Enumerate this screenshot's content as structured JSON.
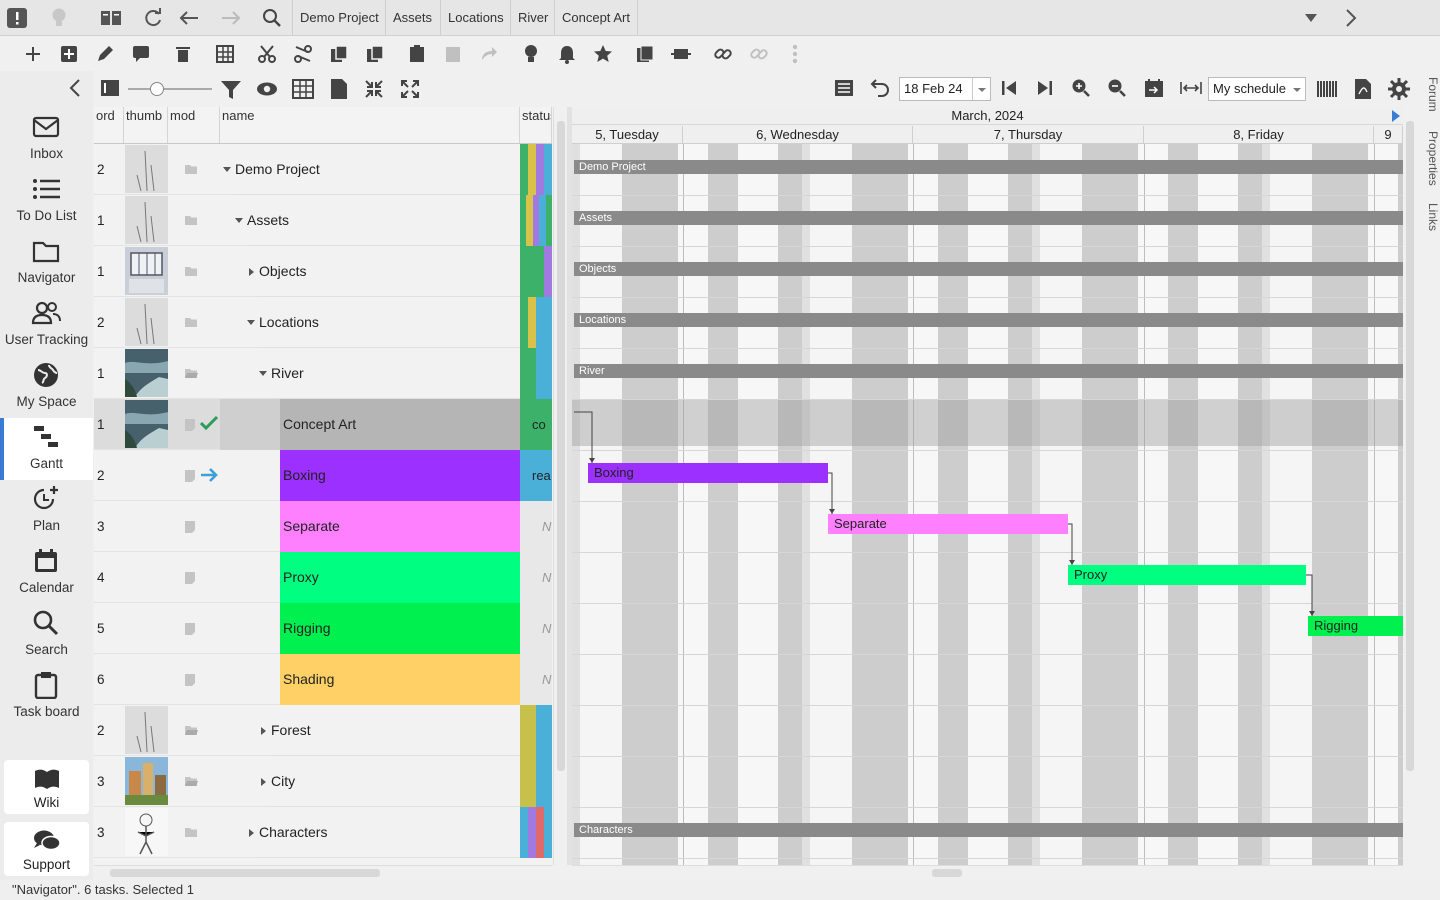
{
  "breadcrumbs": [
    "Demo Project",
    "Assets",
    "Locations",
    "River",
    "Concept Art"
  ],
  "schedule_toolbar": {
    "date": "18 Feb 24",
    "schedule": "My schedule"
  },
  "sidebar": {
    "items": [
      {
        "label": "Inbox",
        "icon": "inbox-icon"
      },
      {
        "label": "To Do List",
        "icon": "todo-list-icon"
      },
      {
        "label": "Navigator",
        "icon": "folder-icon"
      },
      {
        "label": "User Tracking",
        "icon": "users-icon"
      },
      {
        "label": "My Space",
        "icon": "globe-icon"
      },
      {
        "label": "Gantt",
        "icon": "gantt-icon",
        "active": true
      },
      {
        "label": "Plan",
        "icon": "plan-icon"
      },
      {
        "label": "Calendar",
        "icon": "calendar-icon"
      },
      {
        "label": "Search",
        "icon": "search-icon"
      },
      {
        "label": "Task board",
        "icon": "clipboard-icon"
      }
    ],
    "wiki": "Wiki",
    "support": "Support"
  },
  "table": {
    "columns": [
      "ord",
      "thumb",
      "mod",
      "name",
      "status"
    ],
    "rows": [
      {
        "ord": "2",
        "name": "Demo Project",
        "indent": 0,
        "arrow": "down",
        "thumb": "sketch",
        "mod": "folder"
      },
      {
        "ord": "1",
        "name": "Assets",
        "indent": 1,
        "arrow": "down",
        "thumb": "sketch",
        "mod": "folder"
      },
      {
        "ord": "1",
        "name": "Objects",
        "indent": 2,
        "arrow": "right",
        "thumb": "room",
        "mod": "folder"
      },
      {
        "ord": "2",
        "name": "Locations",
        "indent": 2,
        "arrow": "down",
        "thumb": "sketch",
        "mod": "folder"
      },
      {
        "ord": "1",
        "name": "River",
        "indent": 3,
        "arrow": "down",
        "thumb": "river",
        "mod": "folder-open"
      },
      {
        "ord": "1",
        "name": "Concept Art",
        "indent": 4,
        "thumb": "river",
        "mod": "doc",
        "check": true,
        "status": "co",
        "color": "#b5b5b5",
        "selected": true
      },
      {
        "ord": "2",
        "name": "Boxing",
        "indent": 4,
        "mod": "doc",
        "arrowIcon": true,
        "status": "rea",
        "color": "#9b30ff"
      },
      {
        "ord": "3",
        "name": "Separate",
        "indent": 4,
        "mod": "doc",
        "status": "N",
        "color": "#ff80ff"
      },
      {
        "ord": "4",
        "name": "Proxy",
        "indent": 4,
        "mod": "doc",
        "status": "N",
        "color": "#00ff80"
      },
      {
        "ord": "5",
        "name": "Rigging",
        "indent": 4,
        "mod": "doc",
        "status": "N",
        "color": "#00f050"
      },
      {
        "ord": "6",
        "name": "Shading",
        "indent": 4,
        "mod": "doc",
        "status": "N",
        "color": "#ffd066"
      },
      {
        "ord": "2",
        "name": "Forest",
        "indent": 3,
        "arrow": "right",
        "thumb": "sketch",
        "mod": "folder-open"
      },
      {
        "ord": "3",
        "name": "City",
        "indent": 3,
        "arrow": "right",
        "thumb": "city",
        "mod": "folder-open"
      },
      {
        "ord": "3",
        "name": "Characters",
        "indent": 2,
        "arrow": "right",
        "thumb": "character",
        "mod": "folder"
      }
    ]
  },
  "gantt": {
    "month": "March, 2024",
    "days": [
      "5, Tuesday",
      "6, Wednesday",
      "7, Thursday",
      "8, Friday",
      "9"
    ],
    "bars": [
      "Demo Project",
      "Assets",
      "Objects",
      "Locations",
      "River",
      "Characters"
    ],
    "tasks": [
      {
        "name": "Boxing",
        "color": "#9b30ff"
      },
      {
        "name": "Separate",
        "color": "#ff80ff"
      },
      {
        "name": "Proxy",
        "color": "#00ff80"
      },
      {
        "name": "Rigging",
        "color": "#00f050"
      }
    ]
  },
  "right_tabs": [
    "Forum",
    "Properties",
    "Links"
  ],
  "statusbar": "\"Navigator\". 6 tasks. Selected 1"
}
